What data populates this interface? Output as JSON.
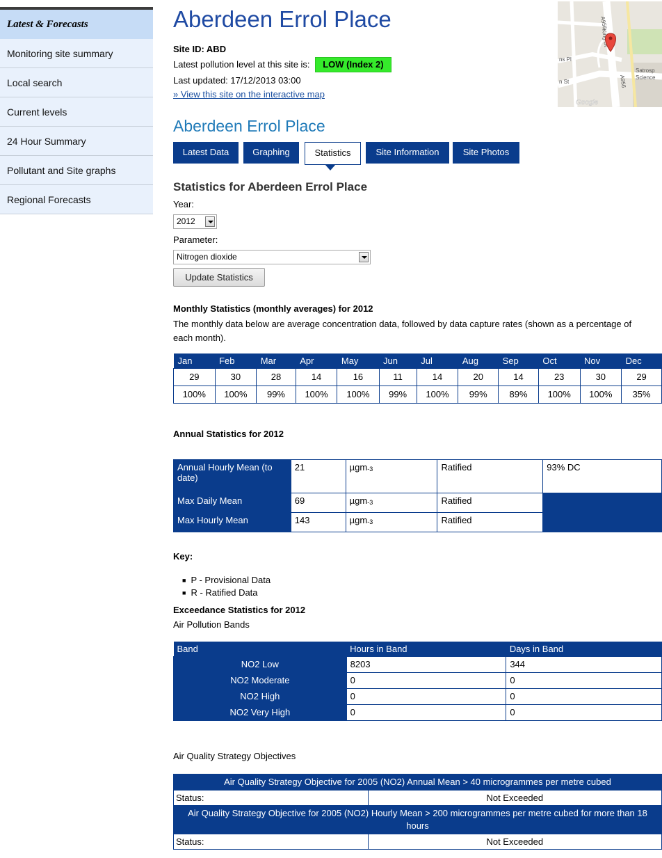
{
  "sidebar": {
    "header": "Latest & Forecasts",
    "items": [
      {
        "label": "Monitoring site summary"
      },
      {
        "label": "Local search"
      },
      {
        "label": "Current levels"
      },
      {
        "label": "24 Hour Summary"
      },
      {
        "label": "Pollutant and Site graphs"
      },
      {
        "label": "Regional Forecasts"
      }
    ]
  },
  "header": {
    "title": "Aberdeen Errol Place",
    "site_id": "Site ID: ABD",
    "pollution_label": "Latest pollution level at this site is:",
    "pollution_badge": "LOW (Index 2)",
    "last_updated": "Last updated: 17/12/2013 03:00",
    "map_link": "» View this site on the interactive map"
  },
  "map": {
    "labels": [
      "A956",
      "King St",
      "A956",
      "ns Pl",
      "n St",
      "Satrosp",
      "Science"
    ],
    "watermark": "Google"
  },
  "sub_title": "Aberdeen Errol Place",
  "tabs": [
    {
      "label": "Latest Data"
    },
    {
      "label": "Graphing"
    },
    {
      "label": "Statistics"
    },
    {
      "label": "Site Information"
    },
    {
      "label": "Site Photos"
    }
  ],
  "stats": {
    "title": "Statistics for Aberdeen Errol Place",
    "year_label": "Year:",
    "year_value": "2012",
    "param_label": "Parameter:",
    "param_value": "Nitrogen dioxide",
    "update_button": "Update Statistics"
  },
  "monthly": {
    "title": "Monthly Statistics (monthly averages) for 2012",
    "description": "The monthly data below are average concentration data, followed by data capture rates (shown as a percentage of each month).",
    "months": [
      "Jan",
      "Feb",
      "Mar",
      "Apr",
      "May",
      "Jun",
      "Jul",
      "Aug",
      "Sep",
      "Oct",
      "Nov",
      "Dec"
    ],
    "averages": [
      "29",
      "30",
      "28",
      "14",
      "16",
      "11",
      "14",
      "20",
      "14",
      "23",
      "30",
      "29"
    ],
    "capture": [
      "100%",
      "100%",
      "99%",
      "100%",
      "100%",
      "99%",
      "100%",
      "99%",
      "89%",
      "100%",
      "100%",
      "35%"
    ]
  },
  "annual": {
    "title": "Annual Statistics for 2012",
    "unit_base": "µgm",
    "unit_exp": "-3",
    "dc": "93% DC",
    "rows": [
      {
        "label": "Annual Hourly Mean (to date)",
        "value": "21",
        "status": "Ratified"
      },
      {
        "label": "Max Daily Mean",
        "value": "69",
        "status": "Ratified"
      },
      {
        "label": "Max Hourly Mean",
        "value": "143",
        "status": "Ratified"
      }
    ]
  },
  "key": {
    "title": "Key:",
    "items": [
      "P - Provisional Data",
      "R - Ratified Data"
    ]
  },
  "exceedance": {
    "title": "Exceedance Statistics for 2012",
    "bands_subtitle": "Air Pollution Bands",
    "headers": [
      "Band",
      "Hours in Band",
      "Days in Band"
    ],
    "rows": [
      {
        "band": "NO2 Low",
        "hours": "8203",
        "days": "344"
      },
      {
        "band": "NO2 Moderate",
        "hours": "0",
        "days": "0"
      },
      {
        "band": "NO2 High",
        "hours": "0",
        "days": "0"
      },
      {
        "band": "NO2 Very High",
        "hours": "0",
        "days": "0"
      }
    ]
  },
  "aqso": {
    "subtitle": "Air Quality Strategy Objectives",
    "objectives": [
      {
        "text": "Air Quality Strategy Objective for 2005 (NO2) Annual Mean > 40 microgrammes per metre cubed",
        "status_label": "Status:",
        "status": "Not Exceeded"
      },
      {
        "text": "Air Quality Strategy Objective for 2005 (NO2) Hourly Mean > 200 microgrammes per metre cubed for more than 18 hours",
        "status_label": "Status:",
        "status": "Not Exceeded"
      }
    ]
  }
}
